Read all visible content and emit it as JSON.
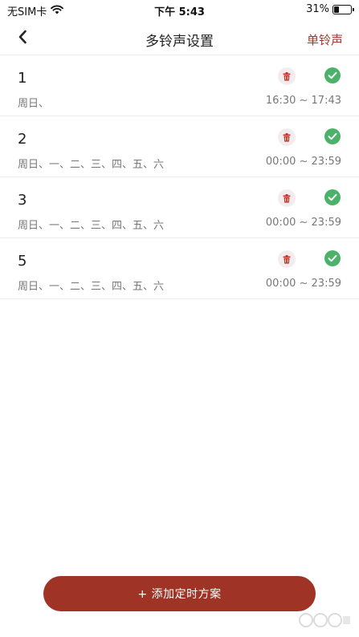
{
  "status_bar": {
    "carrier": "无SIM卡",
    "time": "下午 5:43",
    "battery": "31%",
    "battery_level": 0.31
  },
  "nav": {
    "title": "多铃声设置",
    "action_label": "单铃声"
  },
  "schedules": [
    {
      "name": "1",
      "days": "周日、",
      "time": "16:30 ~ 17:43"
    },
    {
      "name": "2",
      "days": "周日、一、二、三、四、五、六",
      "time": "00:00 ~ 23:59"
    },
    {
      "name": "3",
      "days": "周日、一、二、三、四、五、六",
      "time": "00:00 ~ 23:59"
    },
    {
      "name": "5",
      "days": "周日、一、二、三、四、五、六",
      "time": "00:00 ~ 23:59"
    }
  ],
  "add_button_label": "+ 添加定时方案",
  "colors": {
    "accent": "#9e3326",
    "check_green": "#4cb26a",
    "delete_red": "#c0392b"
  },
  "icons": {
    "back": "chevron-left-icon",
    "delete": "trash-icon",
    "enabled": "check-circle-icon",
    "wifi": "wifi-icon",
    "battery": "battery-icon"
  }
}
